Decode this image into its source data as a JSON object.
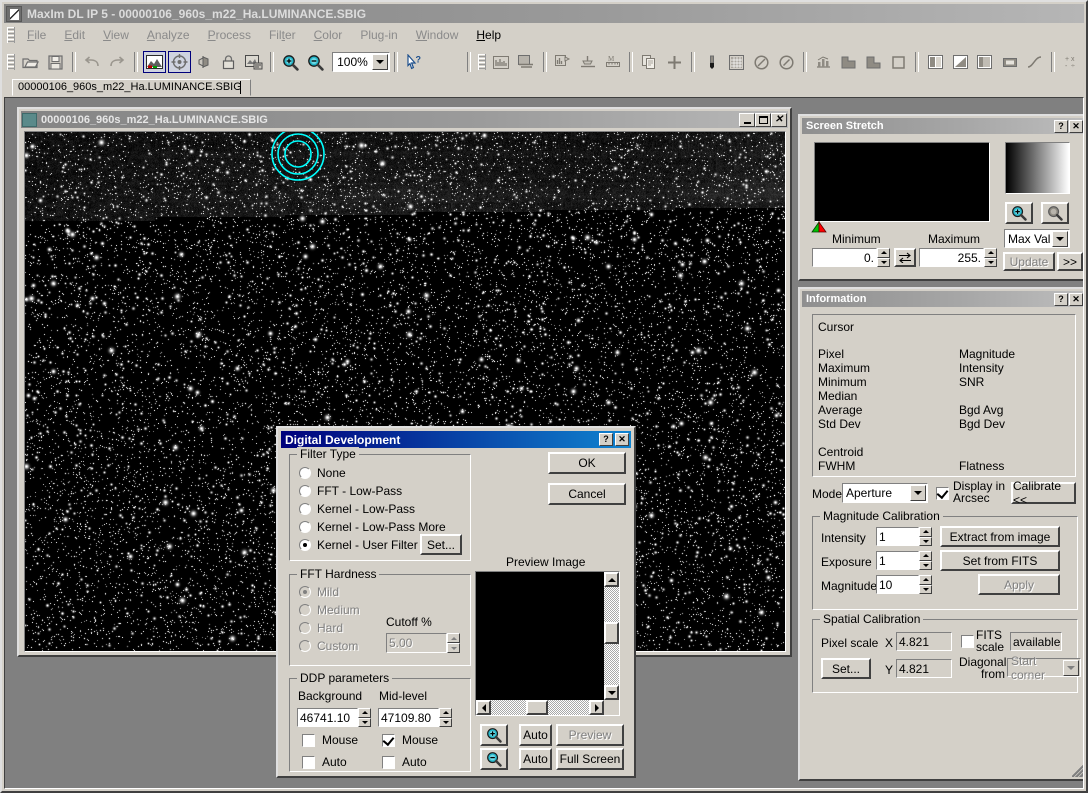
{
  "app": {
    "title": "MaxIm DL IP 5 - 00000106_960s_m22_Ha.LUMINANCE.SBIG",
    "icon": "maxim-app-icon"
  },
  "menu": {
    "items": [
      {
        "label": "File",
        "enabled": false
      },
      {
        "label": "Edit",
        "enabled": false
      },
      {
        "label": "View",
        "enabled": false
      },
      {
        "label": "Analyze",
        "enabled": false
      },
      {
        "label": "Process",
        "enabled": false
      },
      {
        "label": "Filter",
        "enabled": false
      },
      {
        "label": "Color",
        "enabled": false
      },
      {
        "label": "Plug-in",
        "enabled": false
      },
      {
        "label": "Window",
        "enabled": false
      },
      {
        "label": "Help",
        "enabled": true
      }
    ]
  },
  "toolbar": {
    "zoom_value": "100%",
    "icons": [
      "open-folder-icon",
      "save-disk-icon",
      "undo-icon",
      "redo-icon",
      "image-display-icon",
      "crosshair-target-icon",
      "flip-image-icon",
      "lock-icon",
      "screen-settings-icon",
      "zoom-in-icon",
      "zoom-out-icon"
    ],
    "icons_right": [
      "histogram-icon",
      "color-table-icon",
      "line-profile-icon",
      "flatten-icon",
      "measure-icon",
      "copy-icon",
      "add-icon",
      "brush-icon",
      "grid-icon",
      "circle-slash-icon",
      "circle-slash2-icon",
      "bar-chart-icon",
      "cut-corner-icon",
      "fill-corner-icon",
      "square-icon",
      "pattern1-icon",
      "pattern2-icon",
      "pattern3-icon",
      "box-icon",
      "curve-icon",
      "math-ops-icon"
    ]
  },
  "doc_tab": {
    "label": "00000106_960s_m22_Ha.LUMINANCE.SBIG"
  },
  "child_window": {
    "title": "00000106_960s_m22_Ha.LUMINANCE.SBIG",
    "icon": "document-image-icon",
    "buttons": [
      "minimize-button",
      "maximize-button",
      "close-button"
    ],
    "annotation_color": "#00ffff"
  },
  "screen_stretch": {
    "title": "Screen Stretch",
    "help_label": "?",
    "close_label": "✕",
    "minimum_label": "Minimum",
    "maximum_label": "Maximum",
    "minimum_value": "0.",
    "maximum_value": "255.",
    "swap_icon": "swap-arrows-icon",
    "mode_value": "Max Val",
    "update_label": "Update",
    "expand_label": ">>",
    "zoom_in_icon": "zoom-in-icon",
    "zoom_out_icon": "zoom-out-icon",
    "marker_low_color": "#00c000",
    "marker_high_color": "#ff0000"
  },
  "information": {
    "title": "Information",
    "help_label": "?",
    "close_label": "✕",
    "readout": {
      "cursor": "Cursor",
      "left": [
        "Pixel",
        "Maximum",
        "Minimum",
        "Median",
        "Average",
        "Std Dev"
      ],
      "right": [
        "Magnitude",
        "Intensity",
        "SNR",
        "",
        "Bgd Avg",
        "Bgd Dev"
      ],
      "centroid": "Centroid",
      "fwhm": "FWHM",
      "flatness": "Flatness"
    },
    "mode_label": "Mode",
    "mode_value": "Aperture",
    "display_arcsec_label": "Display in Arcsec",
    "display_arcsec_checked": true,
    "calibrate_label": "Calibrate <<",
    "magnitude_calibration": {
      "legend": "Magnitude Calibration",
      "intensity_label": "Intensity",
      "intensity_value": "1",
      "exposure_label": "Exposure",
      "exposure_value": "1",
      "magnitude_label": "Magnitude",
      "magnitude_value": "10",
      "extract_label": "Extract from image",
      "set_fits_label": "Set from FITS",
      "apply_label": "Apply",
      "apply_enabled": false
    },
    "spatial_calibration": {
      "legend": "Spatial Calibration",
      "pixel_scale_label": "Pixel scale",
      "x_label": "X",
      "x_value": "4.821",
      "y_label": "Y",
      "y_value": "4.821",
      "set_label": "Set...",
      "fits_scale_label": "FITS scale",
      "fits_scale_checked": false,
      "fits_scale_value": "available",
      "diagonal_from_label": "Diagonal from",
      "diagonal_from_value": "Start corner"
    }
  },
  "dialog": {
    "title": "Digital Development",
    "help_label": "?",
    "close_label": "✕",
    "ok_label": "OK",
    "cancel_label": "Cancel",
    "filter_type": {
      "legend": "Filter Type",
      "options": [
        {
          "label": "None",
          "selected": false
        },
        {
          "label": "FFT - Low-Pass",
          "selected": false
        },
        {
          "label": "Kernel - Low-Pass",
          "selected": false
        },
        {
          "label": "Kernel - Low-Pass More",
          "selected": false
        },
        {
          "label": "Kernel - User Filter",
          "selected": true
        }
      ],
      "set_label": "Set..."
    },
    "fft_hardness": {
      "legend": "FFT Hardness",
      "enabled": false,
      "options": [
        {
          "label": "Mild",
          "selected": true
        },
        {
          "label": "Medium",
          "selected": false
        },
        {
          "label": "Hard",
          "selected": false
        },
        {
          "label": "Custom",
          "selected": false
        }
      ],
      "cutoff_label": "Cutoff %",
      "cutoff_value": "5.00"
    },
    "ddp_parameters": {
      "legend": "DDP parameters",
      "background_label": "Background",
      "background_value": "46741.10",
      "background_mouse_label": "Mouse",
      "background_mouse_checked": false,
      "background_auto_label": "Auto",
      "background_auto_checked": false,
      "midlevel_label": "Mid-level",
      "midlevel_value": "47109.80",
      "midlevel_mouse_label": "Mouse",
      "midlevel_mouse_checked": true,
      "midlevel_auto_label": "Auto",
      "midlevel_auto_checked": false
    },
    "preview": {
      "title": "Preview Image",
      "zoom_in_icon": "zoom-in-icon",
      "zoom_out_icon": "zoom-out-icon",
      "auto_top_label": "Auto",
      "auto_bottom_label": "Auto",
      "preview_label": "Preview",
      "preview_enabled": false,
      "full_screen_label": "Full Screen"
    }
  },
  "colors": {
    "face": "#d4d0c8",
    "workspace": "#808080",
    "title_active": "#00007b",
    "title_inactive": "#9a9a9a",
    "accent_cyan": "#00ffff"
  }
}
